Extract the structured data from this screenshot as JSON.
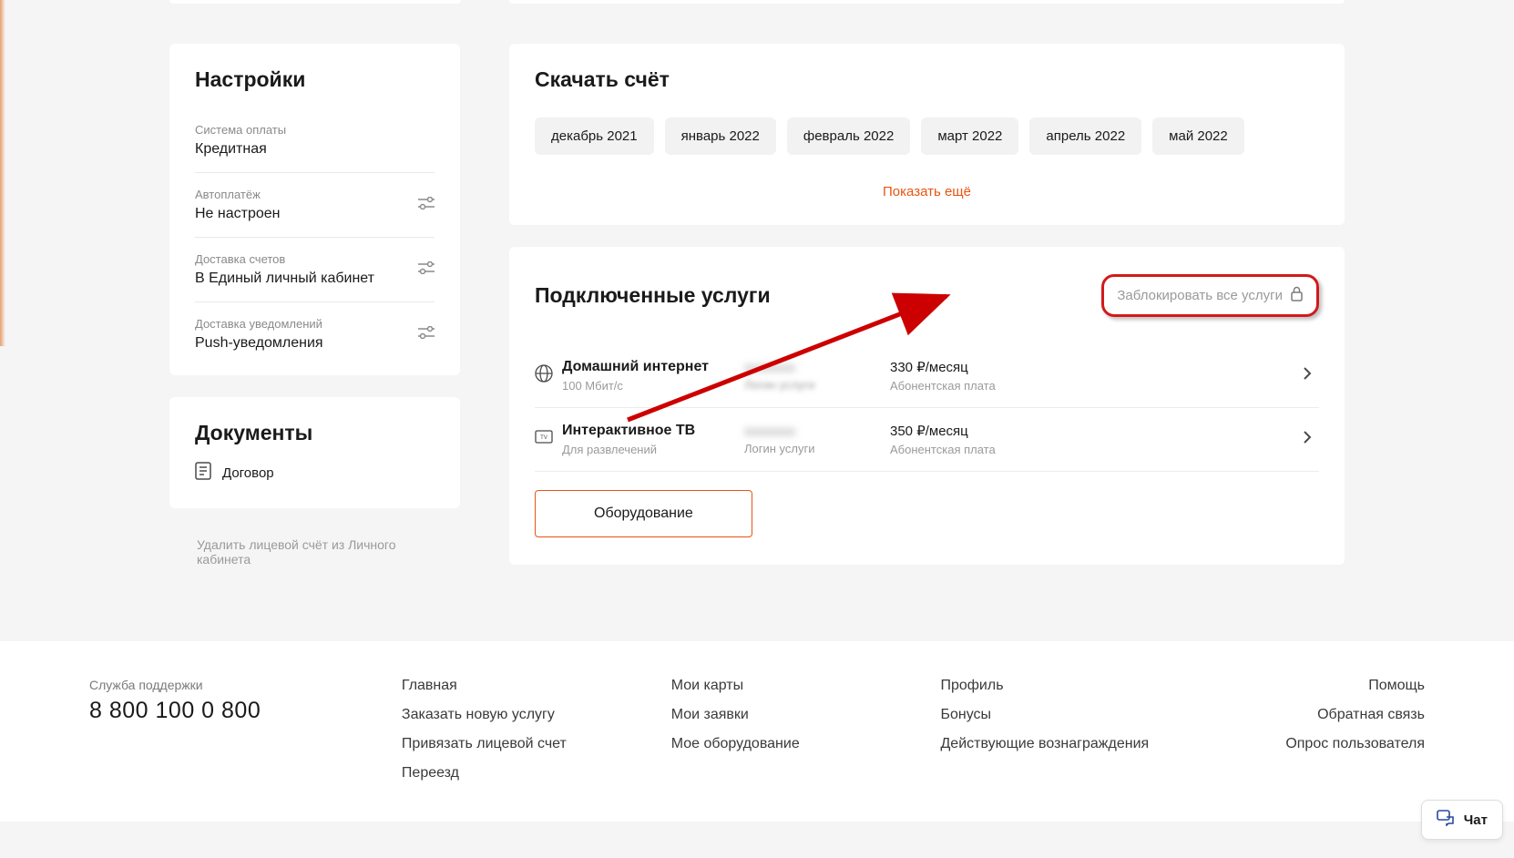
{
  "sidebar": {
    "settings_title": "Настройки",
    "items": [
      {
        "label": "Система оплаты",
        "value": "Кредитная",
        "has_icon": false
      },
      {
        "label": "Автоплатёж",
        "value": "Не настроен",
        "has_icon": true
      },
      {
        "label": "Доставка счетов",
        "value": "В Единый личный кабинет",
        "has_icon": true
      },
      {
        "label": "Доставка уведомлений",
        "value": "Push-уведомления",
        "has_icon": true
      }
    ],
    "documents_title": "Документы",
    "documents": [
      {
        "label": "Договор"
      }
    ],
    "delete_link": "Удалить лицевой счёт из Личного кабинета"
  },
  "download": {
    "title": "Скачать счёт",
    "months": [
      "декабрь 2021",
      "январь 2022",
      "февраль 2022",
      "март 2022",
      "апрель 2022",
      "май 2022"
    ],
    "show_more": "Показать ещё"
  },
  "services": {
    "title": "Подключенные услуги",
    "block_all": "Заблокировать все услуги",
    "rows": [
      {
        "name": "Домашний интернет",
        "sub": "100 Мбит/с",
        "login_label": "Логин услуги",
        "price": "330 ₽/месяц",
        "price_label": "Абонентская плата",
        "login_blurred": true
      },
      {
        "name": "Интерактивное ТВ",
        "sub": "Для развлечений",
        "login_label": "Логин услуги",
        "price": "350 ₽/месяц",
        "price_label": "Абонентская плата",
        "login_blurred": false
      }
    ],
    "equipment_btn": "Оборудование"
  },
  "footer": {
    "support_label": "Служба поддержки",
    "support_phone": "8 800 100 0 800",
    "col1": [
      "Главная",
      "Заказать новую услугу",
      "Привязать лицевой счет",
      "Переезд"
    ],
    "col2": [
      "Мои карты",
      "Мои заявки",
      "Мое оборудование"
    ],
    "col3": [
      "Профиль",
      "Бонусы",
      "Действующие вознаграждения"
    ],
    "col4": [
      "Помощь",
      "Обратная связь",
      "Опрос пользователя"
    ]
  },
  "chat": {
    "label": "Чат"
  }
}
